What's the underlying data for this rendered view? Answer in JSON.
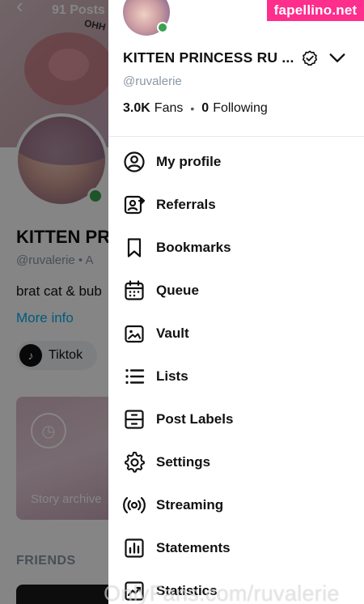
{
  "background_profile": {
    "posts_count": "91 Posts",
    "cover_text": "OHH",
    "name": "KITTEN PR",
    "handle": "@ruvalerie  •  A",
    "bio": "brat cat & bub",
    "more_info": "More info",
    "social_link": "Tiktok",
    "story_label": "Story archive",
    "friends_heading": "FRIENDS"
  },
  "drawer": {
    "display_name": "KITTEN PRINCESS RU ...",
    "handle": "@ruvalerie",
    "fans_count": "3.0K",
    "fans_label": "Fans",
    "following_count": "0",
    "following_label": "Following",
    "menu": [
      {
        "label": "My profile",
        "icon": "profile-icon"
      },
      {
        "label": "Referrals",
        "icon": "referrals-icon"
      },
      {
        "label": "Bookmarks",
        "icon": "bookmark-icon"
      },
      {
        "label": "Queue",
        "icon": "calendar-icon"
      },
      {
        "label": "Vault",
        "icon": "vault-icon"
      },
      {
        "label": "Lists",
        "icon": "lists-icon"
      },
      {
        "label": "Post Labels",
        "icon": "post-labels-icon"
      },
      {
        "label": "Settings",
        "icon": "gear-icon"
      },
      {
        "label": "Streaming",
        "icon": "streaming-icon"
      },
      {
        "label": "Statements",
        "icon": "statements-icon"
      },
      {
        "label": "Statistics",
        "icon": "statistics-icon"
      }
    ]
  },
  "watermarks": {
    "top": "fapellino.net",
    "bottom": "OnlyFans.com/ruvalerie"
  },
  "colors": {
    "accent": "#00aff0",
    "online": "#3aa14d",
    "watermark_bg": "#ff2d8c"
  }
}
